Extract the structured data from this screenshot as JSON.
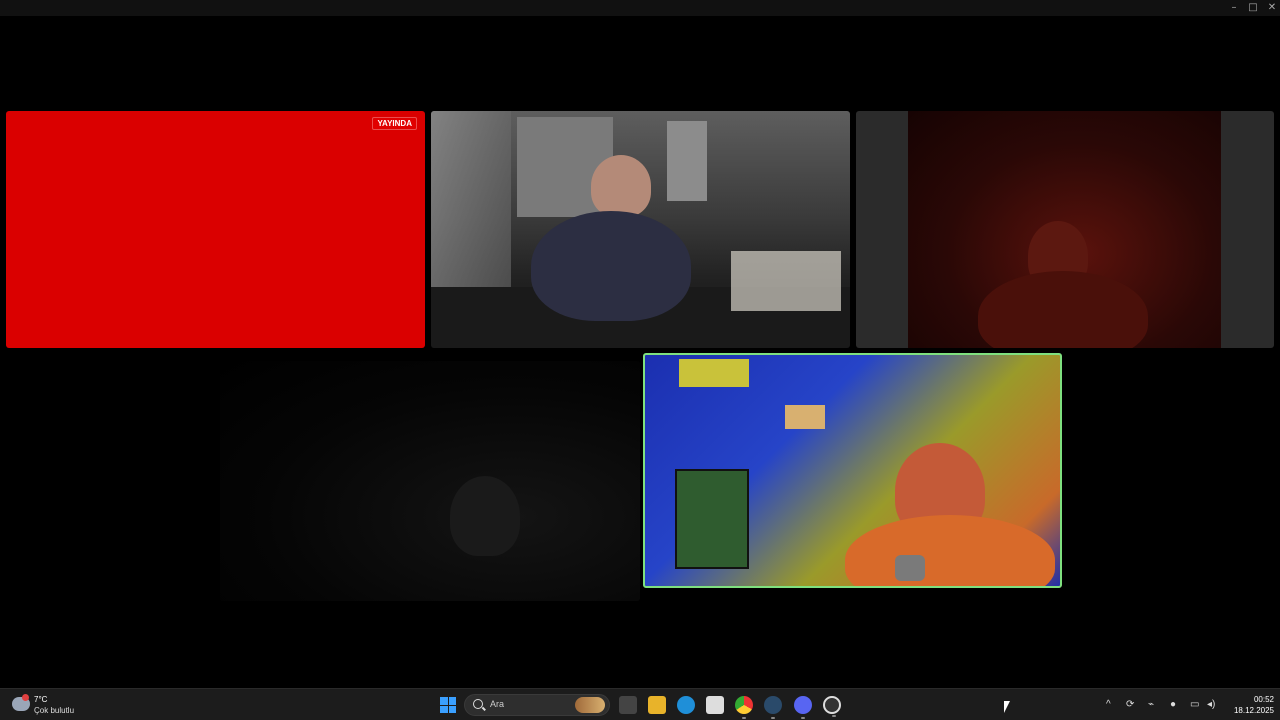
{
  "window": {
    "minimize_icon": "minimize-icon",
    "maximize_icon": "maximize-icon",
    "close_icon": "close-icon"
  },
  "call": {
    "live_badge": "YAYINDA",
    "participants": [
      {
        "tile": "red-screen",
        "color": "#da0000"
      },
      {
        "tile": "room-camera"
      },
      {
        "tile": "dim-red-camera"
      },
      {
        "tile": "dark-camera"
      },
      {
        "tile": "active-speaker-camera",
        "highlight": "#7fe07f"
      }
    ]
  },
  "taskbar": {
    "weather": {
      "temp": "7°C",
      "desc": "Çok bulutlu"
    },
    "search_placeholder": "Ara",
    "apps": [
      "task-view-icon",
      "file-explorer-icon",
      "edge-icon",
      "store-icon",
      "chrome-icon",
      "steam-icon",
      "discord-icon",
      "app-icon"
    ],
    "clock": {
      "time": "00:52",
      "date": "18.12.2025"
    }
  }
}
